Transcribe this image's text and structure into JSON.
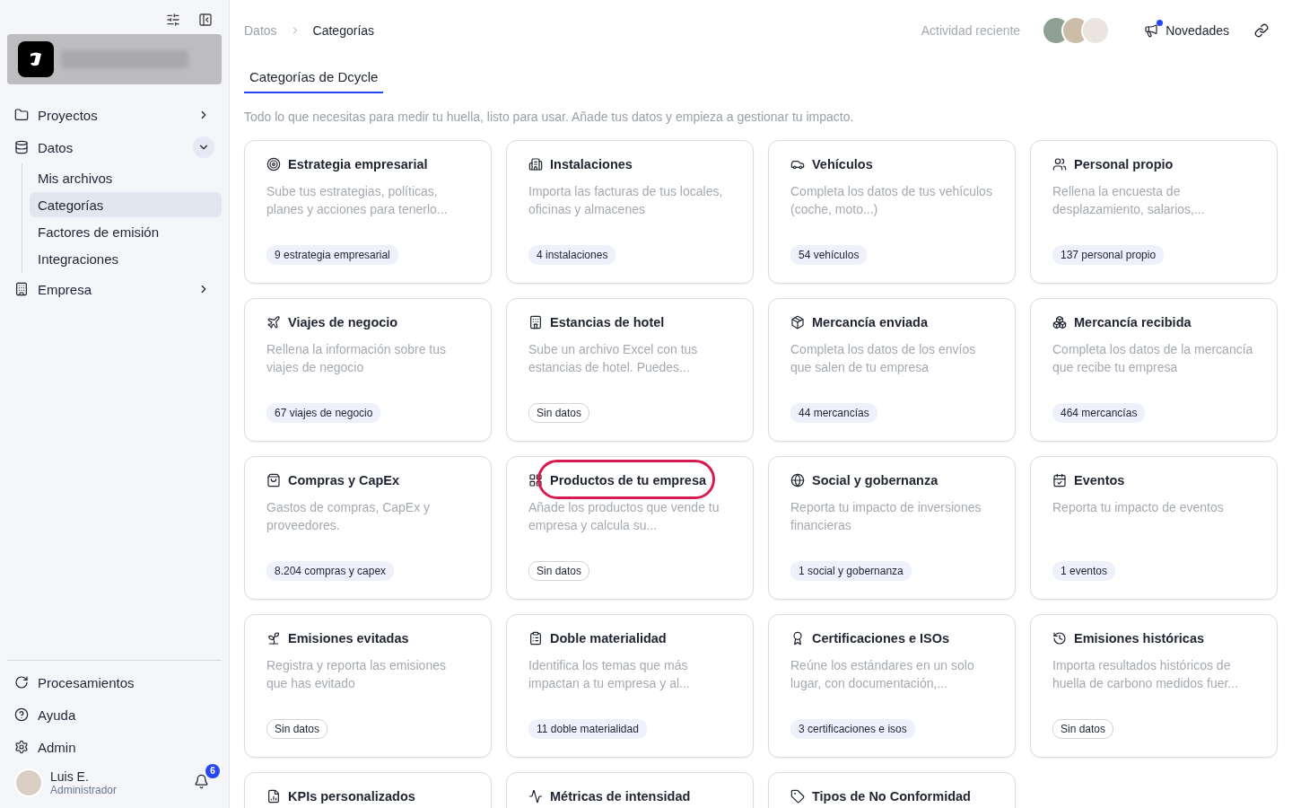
{
  "breadcrumb": [
    {
      "label": "Datos",
      "current": false
    },
    {
      "label": "Categorías",
      "current": true
    }
  ],
  "header": {
    "activity": "Actividad reciente",
    "news": {
      "label": "Novedades",
      "unread": true
    }
  },
  "tabs": [
    {
      "label": "Categorías de Dcycle",
      "selected": true
    }
  ],
  "intro": "Todo lo que necesitas para medir tu huella, listo para usar. Añade tus datos y empieza a gestionar tu impacto.",
  "sidebar": {
    "nav": [
      {
        "label": "Proyectos",
        "expanded": false
      },
      {
        "label": "Datos",
        "expanded": true,
        "children": [
          {
            "label": "Mis archivos",
            "selected": false
          },
          {
            "label": "Categorías",
            "selected": true
          },
          {
            "label": "Factores de emisión",
            "selected": false
          },
          {
            "label": "Integraciones",
            "selected": false
          }
        ]
      },
      {
        "label": "Empresa",
        "expanded": false
      }
    ],
    "footer": [
      "Procesamientos",
      "Ayuda",
      "Admin"
    ],
    "user": {
      "name": "Luis E.",
      "role": "Administrador",
      "notifications": "6"
    }
  },
  "cards": [
    {
      "title": "Estrategia empresarial",
      "description": "Sube tus estrategias, políticas, planes y acciones para tenerlo...",
      "count": "9 estrategia empresarial",
      "empty": false,
      "highlighted": false
    },
    {
      "title": "Instalaciones",
      "description": "Importa las facturas de tus locales, oficinas y almacenes",
      "count": "4 instalaciones",
      "empty": false,
      "highlighted": false
    },
    {
      "title": "Vehículos",
      "description": "Completa los datos de tus vehículos (coche, moto...)",
      "count": "54 vehículos",
      "empty": false,
      "highlighted": false
    },
    {
      "title": "Personal propio",
      "description": "Rellena la encuesta de desplazamiento, salarios,...",
      "count": "137 personal propio",
      "empty": false,
      "highlighted": false
    },
    {
      "title": "Viajes de negocio",
      "description": "Rellena la información sobre tus viajes de negocio",
      "count": "67 viajes de negocio",
      "empty": false,
      "highlighted": false
    },
    {
      "title": "Estancias de hotel",
      "description": "Sube un archivo Excel con tus estancias de hotel. Puedes...",
      "count": "Sin datos",
      "empty": true,
      "highlighted": false
    },
    {
      "title": "Mercancía enviada",
      "description": "Completa los datos de los envíos que salen de tu empresa",
      "count": "44 mercancías",
      "empty": false,
      "highlighted": false
    },
    {
      "title": "Mercancía recibida",
      "description": "Completa los datos de la mercancía que recibe tu empresa",
      "count": "464 mercancías",
      "empty": false,
      "highlighted": false
    },
    {
      "title": "Compras y CapEx",
      "description": "Gastos de compras, CapEx y proveedores.",
      "count": "8.204 compras y capex",
      "empty": false,
      "highlighted": false
    },
    {
      "title": "Productos de tu empresa",
      "description": "Añade los productos que vende tu empresa y calcula su...",
      "count": "Sin datos",
      "empty": true,
      "highlighted": true
    },
    {
      "title": "Social y gobernanza",
      "description": "Reporta tu impacto de inversiones financieras",
      "count": "1 social y gobernanza",
      "empty": false,
      "highlighted": false
    },
    {
      "title": "Eventos",
      "description": "Reporta tu impacto de eventos",
      "count": "1 eventos",
      "empty": false,
      "highlighted": false
    },
    {
      "title": "Emisiones evitadas",
      "description": "Registra y reporta las emisiones que has evitado",
      "count": "Sin datos",
      "empty": true,
      "highlighted": false
    },
    {
      "title": "Doble materialidad",
      "description": "Identifica los temas que más impactan a tu empresa y al...",
      "count": "11 doble materialidad",
      "empty": false,
      "highlighted": false
    },
    {
      "title": "Certificaciones e ISOs",
      "description": "Reúne los estándares en un solo lugar, con documentación,...",
      "count": "3 certificaciones e isos",
      "empty": false,
      "highlighted": false
    },
    {
      "title": "Emisiones históricas",
      "description": "Importa resultados históricos de huella de carbono medidos fuer...",
      "count": "Sin datos",
      "empty": true,
      "highlighted": false
    },
    {
      "title": "KPIs personalizados",
      "highlighted": false
    },
    {
      "title": "Métricas de intensidad",
      "highlighted": false
    },
    {
      "title": "Tipos de No Conformidad",
      "highlighted": false
    }
  ]
}
